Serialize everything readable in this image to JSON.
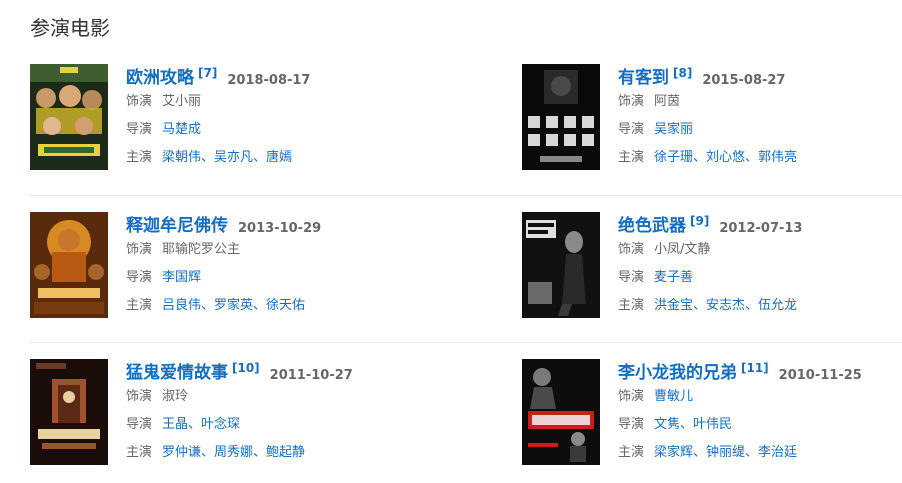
{
  "section_title": "参演电影",
  "movies": [
    {
      "title": "欧洲攻略",
      "ref": "[7]",
      "date": "2018-08-17",
      "role_label": "饰演",
      "role": "艾小丽",
      "director_label": "导演",
      "director": "马楚成",
      "cast_label": "主演",
      "cast": "梁朝伟、吴亦凡、唐嫣",
      "poster_icon": "movie-poster-europe-raiders",
      "poster_colors": [
        "#1d2a1a",
        "#c8b02a",
        "#3f5d2e"
      ]
    },
    {
      "title": "有客到",
      "ref": "[8]",
      "date": "2015-08-27",
      "role_label": "饰演",
      "role": "阿茵",
      "director_label": "导演",
      "director": "吴家丽",
      "cast_label": "主演",
      "cast": "徐子珊、刘心悠、郭伟亮",
      "poster_icon": "movie-poster-guest",
      "poster_colors": [
        "#0a0a0a",
        "#d8d8d8",
        "#4a4a4a"
      ]
    },
    {
      "title": "释迦牟尼佛传",
      "ref": "",
      "date": "2013-10-29",
      "role_label": "饰演",
      "role": "耶输陀罗公主",
      "director_label": "导演",
      "director": "李国辉",
      "cast_label": "主演",
      "cast": "吕良伟、罗家英、徐天佑",
      "poster_icon": "movie-poster-buddha",
      "poster_colors": [
        "#5a2a0c",
        "#d88a22",
        "#f0c060"
      ]
    },
    {
      "title": "绝色武器",
      "ref": "[9]",
      "date": "2012-07-13",
      "role_label": "饰演",
      "role": "小凤/文静",
      "director_label": "导演",
      "director": "麦子善",
      "cast_label": "主演",
      "cast": "洪金宝、安志杰、伍允龙",
      "poster_icon": "movie-poster-naked-soldier",
      "poster_colors": [
        "#111111",
        "#8a8a8a",
        "#e0e0e0"
      ]
    },
    {
      "title": "猛鬼爱情故事",
      "ref": "[10]",
      "date": "2011-10-27",
      "role_label": "饰演",
      "role": "淑玲",
      "director_label": "导演",
      "director": "王晶、叶念琛",
      "cast_label": "主演",
      "cast": "罗仲谦、周秀娜、鲍起静",
      "poster_icon": "movie-poster-ghost-love",
      "poster_colors": [
        "#1a0c08",
        "#a0522d",
        "#e8d0a0"
      ]
    },
    {
      "title": "李小龙我的兄弟",
      "ref": "[11]",
      "date": "2010-11-25",
      "role_label": "饰演",
      "role": "曹敏儿",
      "director_label": "导演",
      "director": "文隽、叶伟民",
      "cast_label": "主演",
      "cast": "梁家辉、钟丽缇、李治廷",
      "poster_icon": "movie-poster-bruce-lee",
      "poster_colors": [
        "#0d0d0d",
        "#c81e1e",
        "#f2f2f2"
      ]
    }
  ]
}
